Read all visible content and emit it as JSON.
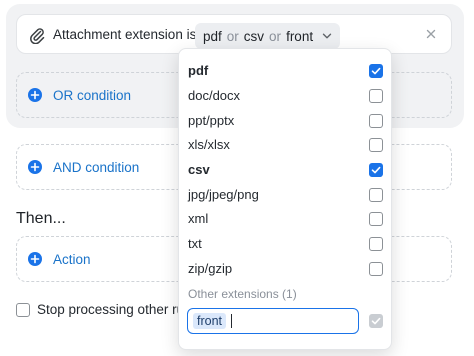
{
  "condition": {
    "label": "Attachment extension is",
    "values": [
      "pdf",
      "csv",
      "front"
    ],
    "joiner": "or"
  },
  "or_condition": {
    "label": "OR condition"
  },
  "and_condition": {
    "label": "AND condition"
  },
  "then": {
    "heading": "Then..."
  },
  "action": {
    "label": "Action"
  },
  "stop_processing": {
    "label": "Stop processing other rules",
    "checked": false
  },
  "dropdown": {
    "options": [
      {
        "label": "pdf",
        "checked": true
      },
      {
        "label": "doc/docx",
        "checked": false
      },
      {
        "label": "ppt/pptx",
        "checked": false
      },
      {
        "label": "xls/xlsx",
        "checked": false
      },
      {
        "label": "csv",
        "checked": true
      },
      {
        "label": "jpg/jpeg/png",
        "checked": false
      },
      {
        "label": "xml",
        "checked": false
      },
      {
        "label": "txt",
        "checked": false
      },
      {
        "label": "zip/gzip",
        "checked": false
      }
    ],
    "other_heading": "Other extensions (1)",
    "custom_value": "front",
    "custom_checked": true
  },
  "colors": {
    "accent": "#1a73e8",
    "link": "#1a73c9",
    "panel_bg": "#f1f2f4"
  },
  "icons": [
    "paperclip-icon",
    "chevron-down-icon",
    "close-icon",
    "plus-circle-icon",
    "checkmark-icon"
  ]
}
